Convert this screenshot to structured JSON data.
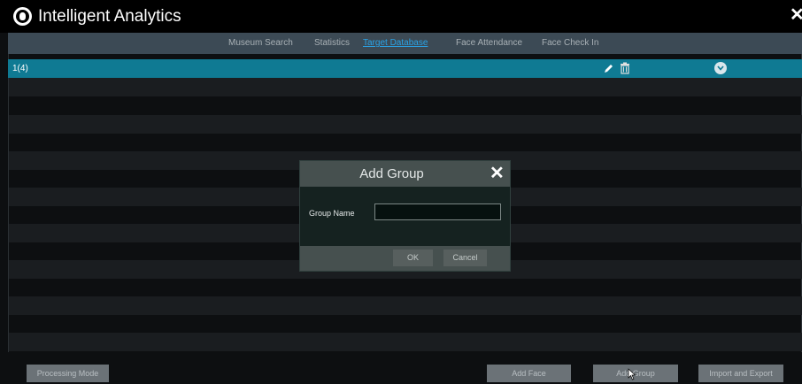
{
  "app": {
    "title": "Intelligent Analytics",
    "close_glyph": "✕"
  },
  "nav": {
    "tabs": [
      {
        "label": "Museum Search",
        "active": false
      },
      {
        "label": "Statistics",
        "active": false
      },
      {
        "label": "Target Database",
        "active": true
      },
      {
        "label": "Face Attendance",
        "active": false
      },
      {
        "label": "Face Check In",
        "active": false
      }
    ]
  },
  "group_list": {
    "rows": [
      {
        "label": "1(4)",
        "icons": [
          "edit-icon",
          "delete-icon",
          "expand-icon"
        ]
      }
    ]
  },
  "dialog": {
    "title": "Add Group",
    "close_glyph": "✕",
    "field_label": "Group Name",
    "field_value": "",
    "ok_label": "OK",
    "cancel_label": "Cancel"
  },
  "bottom_bar": {
    "processing_mode": "Processing Mode",
    "add_face": "Add Face",
    "add_group": "Add Group",
    "import_export": "Import and Export"
  },
  "colors": {
    "accent": "#2aa3e6",
    "selected_row": "#0f7a93",
    "titlebar": "#000000",
    "navbar": "#3c4a55"
  }
}
